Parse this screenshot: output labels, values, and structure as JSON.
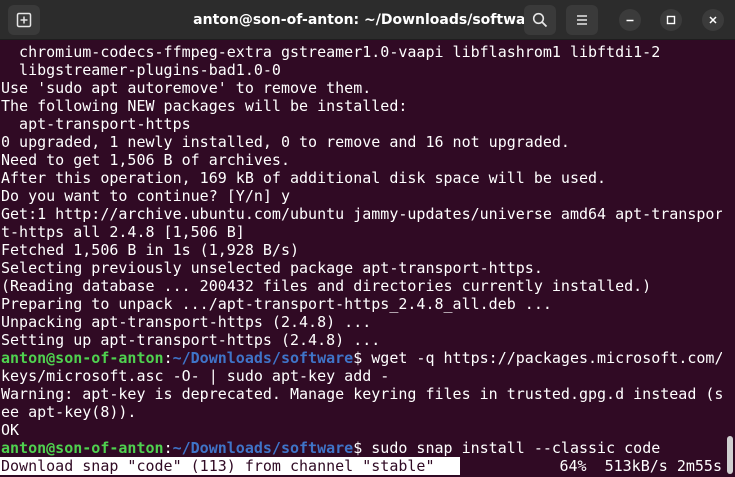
{
  "window": {
    "title": "anton@son-of-anton: ~/Downloads/software"
  },
  "titlebar": {
    "new_tab_icon": "new-tab-icon",
    "search_icon": "search-icon",
    "menu_icon": "hamburger-menu-icon",
    "minimize_icon": "minimize-icon",
    "maximize_icon": "maximize-icon",
    "close_icon": "close-icon"
  },
  "colors": {
    "background": "#300a24",
    "titlebar": "#2c2c2c",
    "prompt_user": "#4fd24f",
    "prompt_path": "#3f74c8",
    "text": "#ffffff"
  },
  "terminal": {
    "lines": [
      "  chromium-codecs-ffmpeg-extra gstreamer1.0-vaapi libflashrom1 libftdi1-2",
      "  libgstreamer-plugins-bad1.0-0",
      "Use 'sudo apt autoremove' to remove them.",
      "The following NEW packages will be installed:",
      "  apt-transport-https",
      "0 upgraded, 1 newly installed, 0 to remove and 16 not upgraded.",
      "Need to get 1,506 B of archives.",
      "After this operation, 169 kB of additional disk space will be used.",
      "Do you want to continue? [Y/n] y",
      "Get:1 http://archive.ubuntu.com/ubuntu jammy-updates/universe amd64 apt-transpor",
      "t-https all 2.4.8 [1,506 B]",
      "Fetched 1,506 B in 1s (1,928 B/s)",
      "Selecting previously unselected package apt-transport-https.",
      "(Reading database ... 200432 files and directories currently installed.)",
      "Preparing to unpack .../apt-transport-https_2.4.8_all.deb ...",
      "Unpacking apt-transport-https (2.4.8) ...",
      "Setting up apt-transport-https (2.4.8) ..."
    ],
    "prompt": {
      "user_host": "anton@son-of-anton",
      "separator": ":",
      "path": "~/Downloads/software",
      "symbol": "$"
    },
    "command_1": " wget -q https://packages.microsoft.com/",
    "command_1_wrap": "keys/microsoft.asc -O- | sudo apt-key add -",
    "output_2": [
      "Warning: apt-key is deprecated. Manage keyring files in trusted.gpg.d instead (s",
      "ee apt-key(8)).",
      "OK"
    ],
    "command_2": " sudo snap install --classic code",
    "progress": {
      "label": "Download snap \"code\" (113) from channel \"stable\"",
      "percent": 64,
      "stats": "64%  513kB/s 2m55s"
    }
  }
}
